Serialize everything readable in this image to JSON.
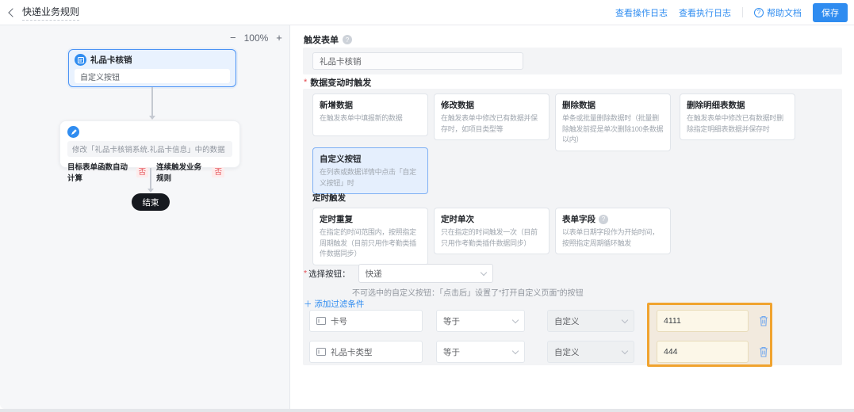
{
  "colors": {
    "accent": "#2f8cf0",
    "annotation": "#f0a32f"
  },
  "topbar": {
    "title": "快递业务规则",
    "link_op_log": "查看操作日志",
    "link_exec_log": "查看执行日志",
    "help": "帮助文档",
    "save": "保存"
  },
  "canvas": {
    "zoom_minus": "−",
    "zoom_level": "100%",
    "zoom_plus": "+",
    "node1": {
      "title": "礼品卡核销",
      "sub": "自定义按钮"
    },
    "node2": {
      "line1": "修改「礼品卡核销系统.礼品卡信息」中的数据",
      "item1_label": "目标表单函数自动计算",
      "item1_value": "否",
      "item2_label": "连续触发业务规则",
      "item2_value": "否"
    },
    "end_node": "结束"
  },
  "panel": {
    "trigger_form_label": "触发表单",
    "trigger_form_value": "礼品卡核销",
    "data_change_label": "数据变动时触发",
    "trigger_cards": [
      {
        "title": "新增数据",
        "desc": "在触发表单中填报新的数据"
      },
      {
        "title": "修改数据",
        "desc": "在触发表单中修改已有数据并保存时，如项目类型等"
      },
      {
        "title": "删除数据",
        "desc": "单条或批量删除数据时（批量删除触发前提是单次删除100条数据以内）"
      },
      {
        "title": "删除明细表数据",
        "desc": "在触发表单中修改已有数据时删除指定明细表数据并保存时"
      }
    ],
    "custom_button_card": {
      "title": "自定义按钮",
      "desc": "在列表或数据详情中点击「自定义按钮」时"
    },
    "timer_label": "定时触发",
    "timer_cards": [
      {
        "title": "定时重复",
        "desc": "在指定的时间范围内，按照指定周期触发（目前只用作考勤类插件数据同步）"
      },
      {
        "title": "定时单次",
        "desc": "只在指定的时间触发一次（目前只用作考勤类插件数据同步）"
      },
      {
        "title": "表单字段",
        "desc": "以表单日期字段作为开始时间，按照指定周期循环触发"
      }
    ],
    "select_button_label": "选择按钮：",
    "select_button_value": "快递",
    "select_note": "不可选中的自定义按钮：「点击后」设置了“打开自定义页面”的按钮",
    "add_filter": "＋ 添加过滤条件",
    "filters": [
      {
        "field": "卡号",
        "operator": "等于",
        "type": "自定义",
        "value": "4111"
      },
      {
        "field": "礼品卡类型",
        "operator": "等于",
        "type": "自定义",
        "value": "444"
      }
    ]
  }
}
